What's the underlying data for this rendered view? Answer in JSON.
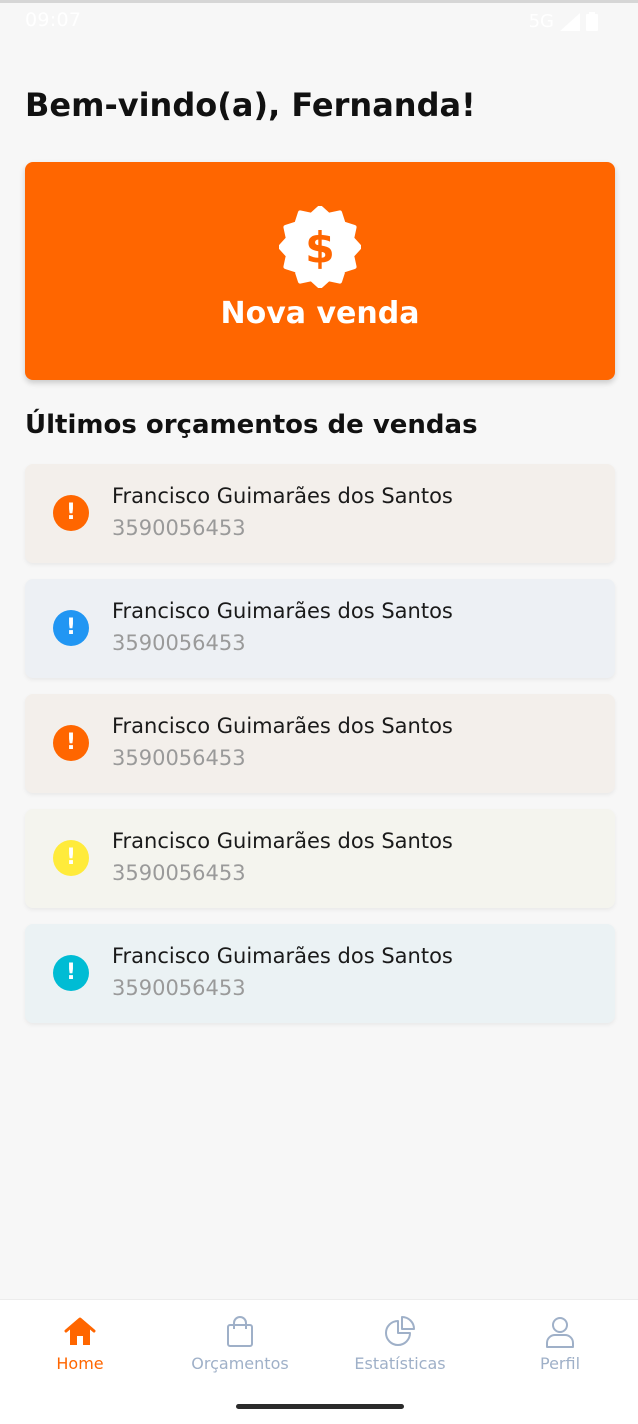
{
  "status_bar": {
    "time": "09:07",
    "network": "5G"
  },
  "greeting": "Bem-vindo(a), Fernanda!",
  "new_sale_button": {
    "label": "Nova venda",
    "icon": "dollar-badge-icon",
    "color": "#ff6600"
  },
  "recent_quotes": {
    "title": "Últimos orçamentos de vendas",
    "items": [
      {
        "name": "Francisco Guimarães dos Santos",
        "phone": "3590056453",
        "status_color": "#ff6600",
        "bg": "#f3efeb"
      },
      {
        "name": "Francisco Guimarães dos Santos",
        "phone": "3590056453",
        "status_color": "#2196f3",
        "bg": "#edf0f4"
      },
      {
        "name": "Francisco Guimarães dos Santos",
        "phone": "3590056453",
        "status_color": "#ff6600",
        "bg": "#f3efeb"
      },
      {
        "name": "Francisco Guimarães dos Santos",
        "phone": "3590056453",
        "status_color": "#ffeb3b",
        "bg": "#f4f4ee"
      },
      {
        "name": "Francisco Guimarães dos Santos",
        "phone": "3590056453",
        "status_color": "#00bcd4",
        "bg": "#ebf2f4"
      }
    ]
  },
  "bottom_nav": {
    "items": [
      {
        "label": "Home",
        "icon": "home-icon",
        "active": true
      },
      {
        "label": "Orçamentos",
        "icon": "shopping-bag-icon",
        "active": false
      },
      {
        "label": "Estatísticas",
        "icon": "pie-chart-icon",
        "active": false
      },
      {
        "label": "Perfil",
        "icon": "user-icon",
        "active": false
      }
    ],
    "active_color": "#ff6600",
    "inactive_color": "#9fb0c8"
  }
}
